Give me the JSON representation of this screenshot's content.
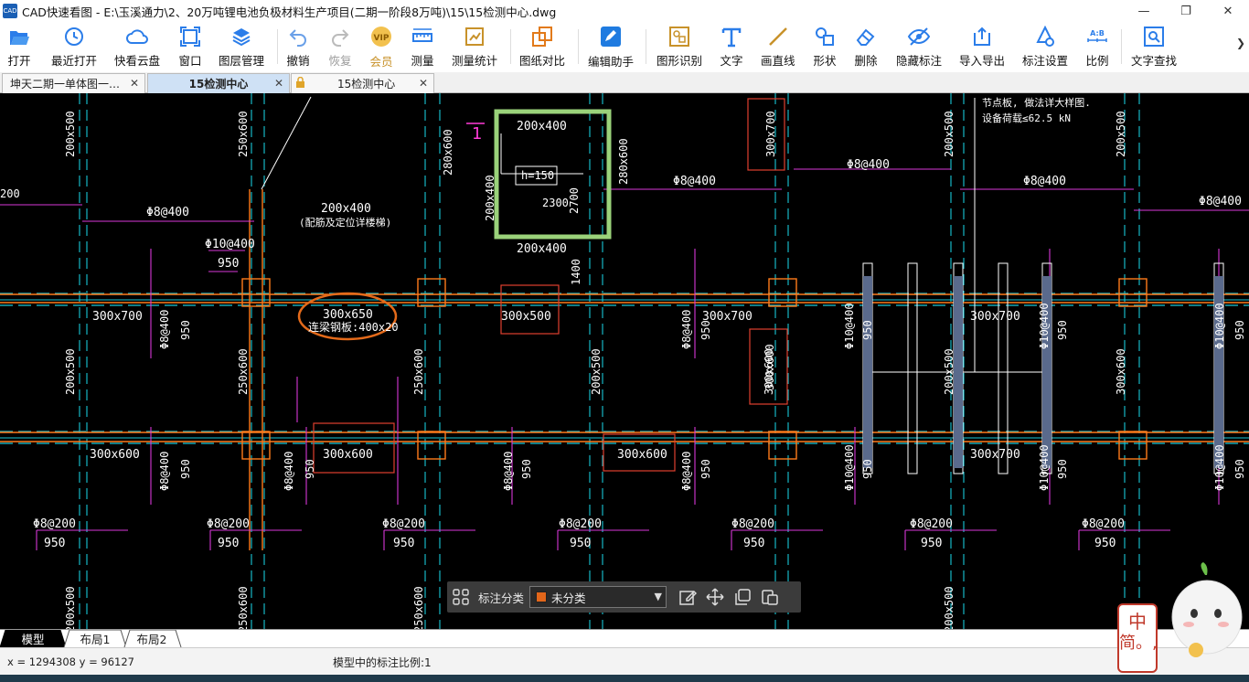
{
  "window": {
    "icon_text": "CAD",
    "title": "CAD快速看图 - E:\\玉溪通力\\2、20万吨锂电池负极材料生产项目(二期一阶段8万吨)\\15\\15检测中心.dwg",
    "minimize": "—",
    "maximize": "❐",
    "close": "✕"
  },
  "toolbar": [
    {
      "label": "打开",
      "icon": "folder-open-icon"
    },
    {
      "label": "最近打开",
      "icon": "clock-icon"
    },
    {
      "label": "快看云盘",
      "icon": "cloud-icon"
    },
    {
      "label": "窗口",
      "icon": "window-icon"
    },
    {
      "label": "图层管理",
      "icon": "layers-icon"
    },
    {
      "label": "撤销",
      "icon": "undo-icon"
    },
    {
      "label": "恢复",
      "icon": "redo-icon"
    },
    {
      "label": "会员",
      "icon": "vip-icon"
    },
    {
      "label": "测量",
      "icon": "ruler-icon"
    },
    {
      "label": "测量统计",
      "icon": "measure-stats-icon"
    },
    {
      "label": "图纸对比",
      "icon": "compare-icon"
    },
    {
      "label": "编辑助手",
      "icon": "edit-assistant-icon"
    },
    {
      "label": "图形识别",
      "icon": "shape-recognize-icon"
    },
    {
      "label": "文字",
      "icon": "text-icon"
    },
    {
      "label": "画直线",
      "icon": "line-icon"
    },
    {
      "label": "形状",
      "icon": "shapes-icon"
    },
    {
      "label": "删除",
      "icon": "eraser-icon"
    },
    {
      "label": "隐藏标注",
      "icon": "eye-hidden-icon"
    },
    {
      "label": "导入导出",
      "icon": "import-export-icon"
    },
    {
      "label": "标注设置",
      "icon": "annotation-settings-icon"
    },
    {
      "label": "比例",
      "icon": "scale-icon"
    },
    {
      "label": "文字查找",
      "icon": "text-search-icon"
    }
  ],
  "toolbar_more": "❯",
  "tabs": [
    {
      "label": "坤天二期一单体图一…",
      "close": "✕"
    },
    {
      "label": "15检测中心",
      "close": "✕"
    },
    {
      "label": "15检测中心",
      "close": "✕"
    }
  ],
  "drawing": {
    "top_note_1": "节点板, 做法详大样图.",
    "top_note_2": "设备荷载≤62.5 kN",
    "beams": [
      "300x700",
      "300x650",
      "300x500",
      "300x700",
      "300x600",
      "300x600",
      "300x600",
      "300x700",
      "200x400",
      "200x400",
      "300x700",
      "300x600",
      "200x400"
    ],
    "column_labels": [
      "200x500",
      "250x600",
      "250x600",
      "280x600",
      "300x700",
      "200x500",
      "300x600",
      "250x600",
      "250x600",
      "200x500",
      "200x500",
      "300x600",
      "200x500",
      "250x600",
      "250x600",
      "250x600"
    ],
    "rebar": [
      "Φ8@400",
      "Φ8@400",
      "Φ8@400",
      "Φ8@400",
      "Φ8@200",
      "Φ8@200",
      "Φ8@200",
      "Φ8@200",
      "Φ8@200",
      "Φ8@200",
      "Φ8@200",
      "Φ10@400",
      "Φ8@400",
      "Φ10@400",
      "Φ8@400",
      "Φ10@400"
    ],
    "dims": [
      "950",
      "1400",
      "2300",
      "2700",
      "h=150",
      "200"
    ],
    "slab_note": "(配筋及定位详楼梯)",
    "circled_note": "连梁钢板:400x20",
    "marker": "1"
  },
  "floatbar": {
    "label": "标注分类",
    "selected": "未分类",
    "swatch_color": "#e2661a"
  },
  "layout_tabs": [
    "模型",
    "布局1",
    "布局2"
  ],
  "status": {
    "coords": "x = 1294308  y = 96127",
    "scale_text": "模型中的标注比例:1"
  },
  "ime": {
    "line1": "中",
    "line2": "简。,"
  }
}
